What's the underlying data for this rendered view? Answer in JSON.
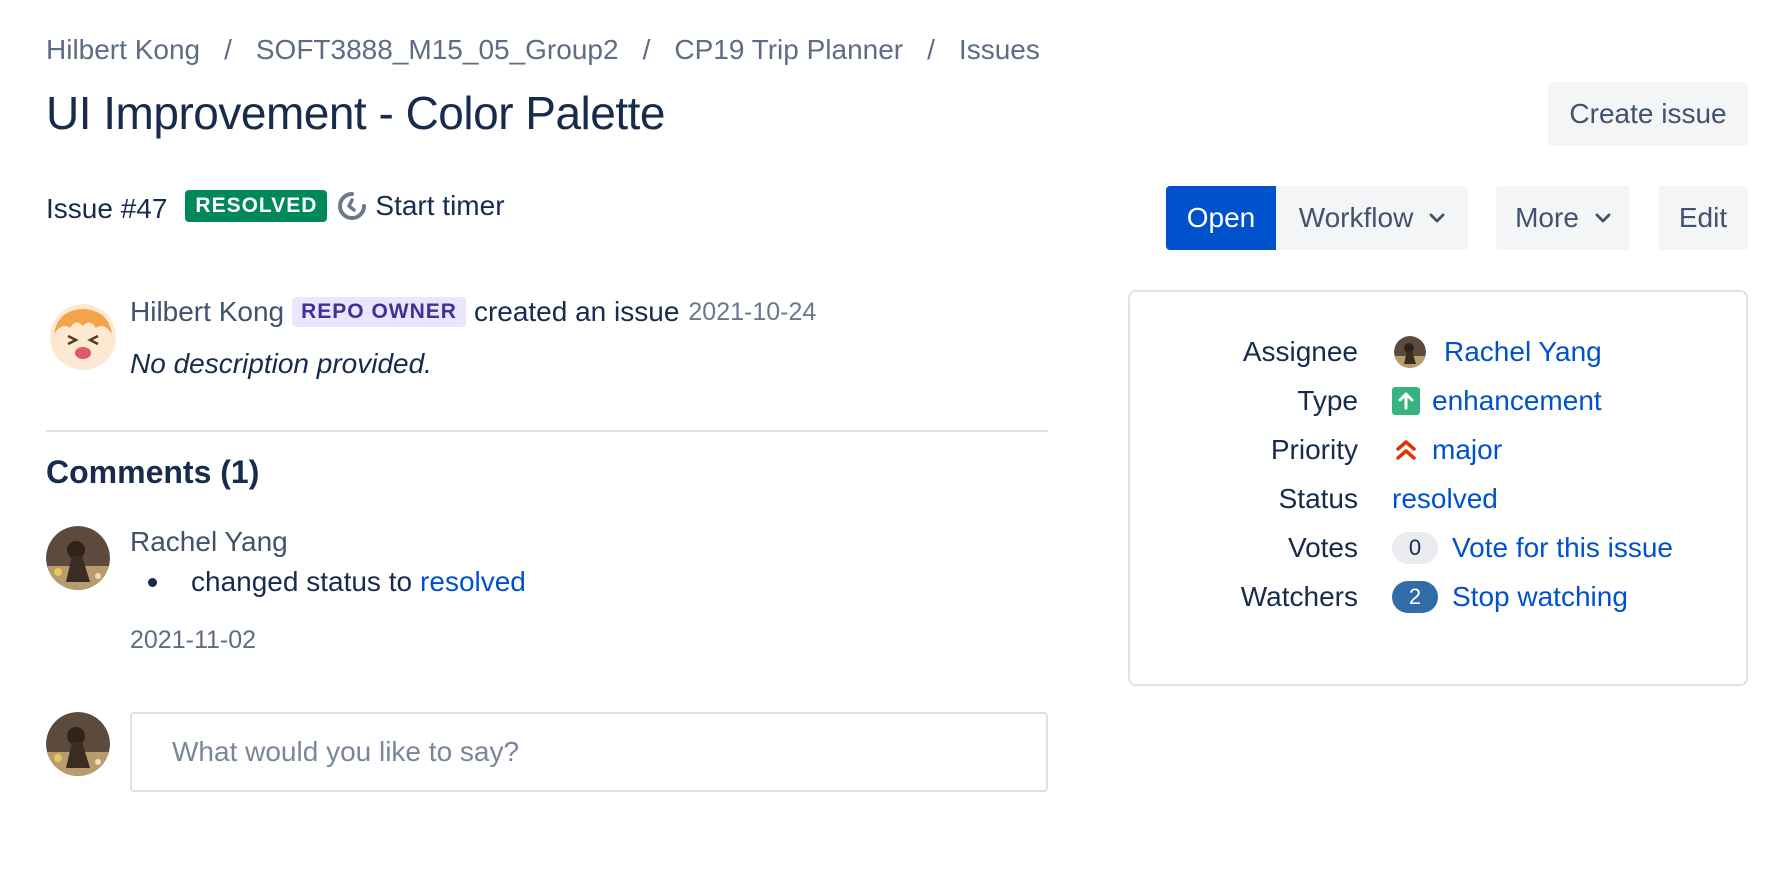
{
  "breadcrumb": {
    "items": [
      "Hilbert Kong",
      "SOFT3888_M15_05_Group2",
      "CP19 Trip Planner",
      "Issues"
    ],
    "separator": "/"
  },
  "title": "UI Improvement - Color Palette",
  "header": {
    "create_issue_label": "Create issue"
  },
  "meta": {
    "issue_number": "Issue #47",
    "status_lozenge": "RESOLVED",
    "timer_label": "Start timer"
  },
  "actions": {
    "open_label": "Open",
    "workflow_label": "Workflow",
    "more_label": "More",
    "edit_label": "Edit"
  },
  "creator": {
    "name": "Hilbert Kong",
    "role_badge": "REPO OWNER",
    "action_text": "created an issue",
    "date": "2021-10-24",
    "description": "No description provided."
  },
  "comments": {
    "heading": "Comments (1)",
    "items": [
      {
        "author": "Rachel Yang",
        "change_text": "changed status to",
        "change_value": "resolved",
        "date": "2021-11-02"
      }
    ]
  },
  "reply": {
    "placeholder": "What would you like to say?"
  },
  "details": {
    "assignee": {
      "label": "Assignee",
      "value": "Rachel Yang"
    },
    "type": {
      "label": "Type",
      "value": "enhancement",
      "icon": "arrow-up-icon"
    },
    "priority": {
      "label": "Priority",
      "value": "major",
      "icon": "double-chevron-up-icon"
    },
    "status": {
      "label": "Status",
      "value": "resolved"
    },
    "votes": {
      "label": "Votes",
      "count": "0",
      "action": "Vote for this issue"
    },
    "watchers": {
      "label": "Watchers",
      "count": "2",
      "action": "Stop watching"
    }
  },
  "colors": {
    "primary": "#0052cc",
    "resolved_green": "#00875a",
    "owner_purple": "#403294",
    "priority_red": "#de350b",
    "watchers_blue": "#2f6ca8"
  }
}
